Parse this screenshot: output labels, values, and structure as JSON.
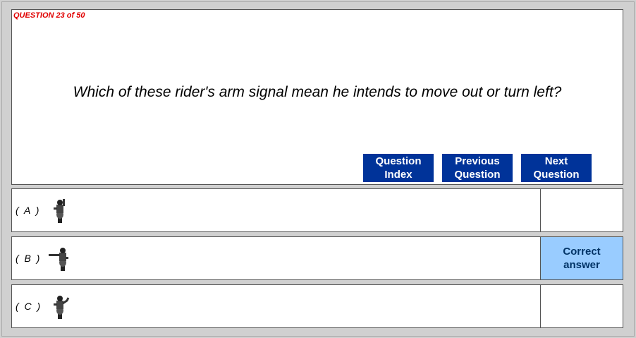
{
  "question": {
    "counter": "QUESTION 23 of 50",
    "text": "Which of these rider's arm signal mean he intends to move out or turn left?"
  },
  "nav": {
    "index_label": "Question\nIndex",
    "previous_label": "Previous\nQuestion",
    "next_label": "Next\nQuestion",
    "button_color": "#003399"
  },
  "answers": [
    {
      "label": "( A )",
      "icon": "rider-arm-raised-icon",
      "result": ""
    },
    {
      "label": "( B )",
      "icon": "rider-arm-extended-left-icon",
      "result": "Correct\nanswer"
    },
    {
      "label": "( C )",
      "icon": "rider-arm-circling-icon",
      "result": ""
    }
  ],
  "colors": {
    "correct_highlight": "#99ccff",
    "counter_red": "#e00000"
  }
}
